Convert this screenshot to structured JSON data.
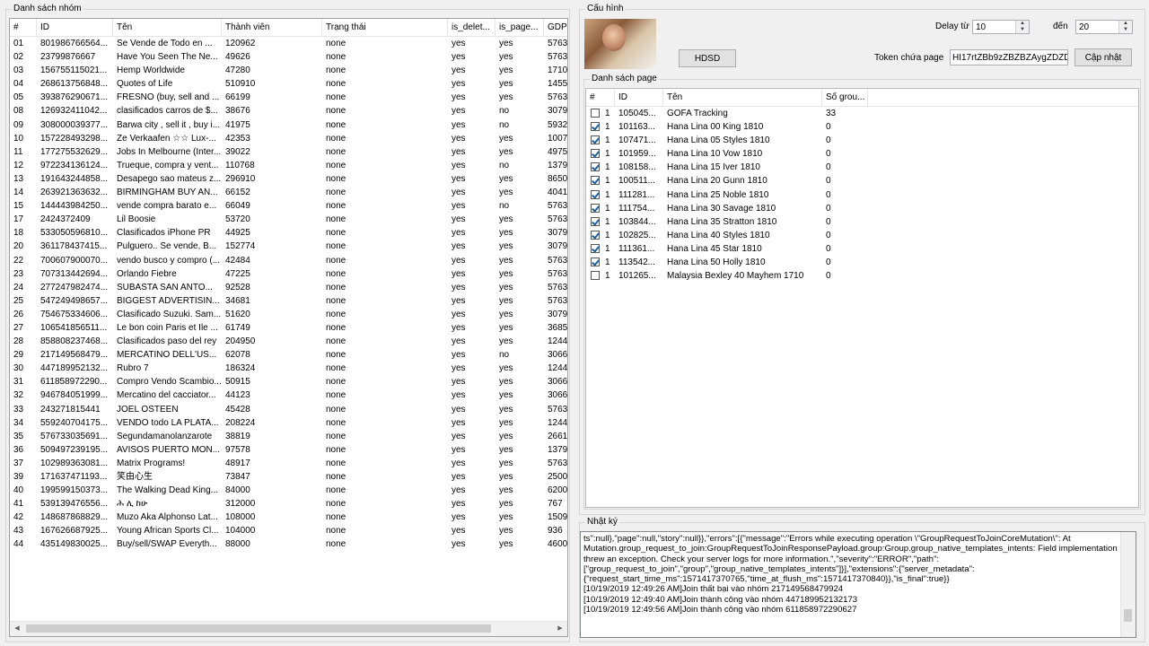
{
  "groups_panel": {
    "title": "Danh sách nhóm",
    "columns": [
      "#",
      "ID",
      "Tên",
      "Thành viên",
      "Trạng thái",
      "is_delet...",
      "is_page...",
      "GDP"
    ],
    "rows": [
      [
        "01",
        "801986766564...",
        "Se Vende de Todo en ...",
        "120962",
        "none",
        "yes",
        "yes",
        "5763"
      ],
      [
        "02",
        "23799876667",
        "Have You Seen The Ne...",
        "49626",
        "none",
        "yes",
        "yes",
        "5763"
      ],
      [
        "03",
        "156755115021...",
        "Hemp Worldwide",
        "47280",
        "none",
        "yes",
        "yes",
        "1710"
      ],
      [
        "04",
        "268613756848...",
        "Quotes of Life",
        "510910",
        "none",
        "yes",
        "yes",
        "1455"
      ],
      [
        "05",
        "393876290671...",
        "FRESNO (buy, sell and ...",
        "66199",
        "none",
        "yes",
        "yes",
        "5763"
      ],
      [
        "08",
        "126932411042...",
        "clasificados carros de $...",
        "38676",
        "none",
        "yes",
        "no",
        "3079"
      ],
      [
        "09",
        "308000039377...",
        "Barwa city , sell it , buy i...",
        "41975",
        "none",
        "yes",
        "no",
        "5932"
      ],
      [
        "10",
        "157228493298...",
        "Ze Verkaafen ☆☆ Lux-...",
        "42353",
        "none",
        "yes",
        "yes",
        "1007"
      ],
      [
        "11",
        "177275532629...",
        "Jobs In Melbourne (Inter...",
        "39022",
        "none",
        "yes",
        "yes",
        "4975"
      ],
      [
        "12",
        "972234136124...",
        "Trueque, compra y vent...",
        "110768",
        "none",
        "yes",
        "no",
        "1379"
      ],
      [
        "13",
        "191643244858...",
        "Desapego sao mateus z...",
        "296910",
        "none",
        "yes",
        "yes",
        "8650"
      ],
      [
        "14",
        "263921363632...",
        "BIRMINGHAM BUY AN...",
        "66152",
        "none",
        "yes",
        "yes",
        "4041"
      ],
      [
        "15",
        "144443984250...",
        "vende compra barato e...",
        "66049",
        "none",
        "yes",
        "no",
        "5763"
      ],
      [
        "17",
        "2424372409",
        "Lil Boosie",
        "53720",
        "none",
        "yes",
        "yes",
        "5763"
      ],
      [
        "18",
        "533050596810...",
        "Clasificados iPhone PR",
        "44925",
        "none",
        "yes",
        "yes",
        "3079"
      ],
      [
        "20",
        "361178437415...",
        "Pulguero.. Se vende, B...",
        "152774",
        "none",
        "yes",
        "yes",
        "3079"
      ],
      [
        "22",
        "700607900070...",
        "vendo busco y compro (...",
        "42484",
        "none",
        "yes",
        "yes",
        "5763"
      ],
      [
        "23",
        "707313442694...",
        "Orlando Fiebre",
        "47225",
        "none",
        "yes",
        "yes",
        "5763"
      ],
      [
        "24",
        "277247982474...",
        "SUBASTA SAN ANTO...",
        "92528",
        "none",
        "yes",
        "yes",
        "5763"
      ],
      [
        "25",
        "547249498657...",
        "BIGGEST ADVERTISIN...",
        "34681",
        "none",
        "yes",
        "yes",
        "5763"
      ],
      [
        "26",
        "754675334606...",
        "Clasificado Suzuki. Sam...",
        "51620",
        "none",
        "yes",
        "yes",
        "3079"
      ],
      [
        "27",
        "106541856511...",
        "Le bon coin Paris et Ile ...",
        "61749",
        "none",
        "yes",
        "yes",
        "3685"
      ],
      [
        "28",
        "858808237468...",
        "Clasificados paso del rey",
        "204950",
        "none",
        "yes",
        "yes",
        "1244"
      ],
      [
        "29",
        "217149568479...",
        "MERCATINO DELL'US...",
        "62078",
        "none",
        "yes",
        "no",
        "3066"
      ],
      [
        "30",
        "447189952132...",
        "Rubro 7",
        "186324",
        "none",
        "yes",
        "yes",
        "1244"
      ],
      [
        "31",
        "611858972290...",
        "Compro Vendo Scambio...",
        "50915",
        "none",
        "yes",
        "yes",
        "3066"
      ],
      [
        "32",
        "946784051999...",
        "Mercatino del cacciator...",
        "44123",
        "none",
        "yes",
        "yes",
        "3066"
      ],
      [
        "33",
        "243271815441",
        "JOEL OSTEEN",
        "45428",
        "none",
        "yes",
        "yes",
        "5763"
      ],
      [
        "34",
        "559240704175...",
        "VENDO todo LA PLATA...",
        "208224",
        "none",
        "yes",
        "yes",
        "1244"
      ],
      [
        "35",
        "576733035691...",
        "Segundamanolanzarote",
        "38819",
        "none",
        "yes",
        "yes",
        "2661"
      ],
      [
        "36",
        "509497239195...",
        "AVISOS PUERTO MON...",
        "97578",
        "none",
        "yes",
        "yes",
        "1379"
      ],
      [
        "37",
        "102989363081...",
        "Matrix Programs!",
        "48917",
        "none",
        "yes",
        "yes",
        "5763"
      ],
      [
        "39",
        "171637471193...",
        "笑由心生",
        "73847",
        "none",
        "yes",
        "yes",
        "2500"
      ],
      [
        "40",
        "199599150373...",
        "The Walking Dead King...",
        "84000",
        "none",
        "yes",
        "yes",
        "6200"
      ],
      [
        "41",
        "539139476556...",
        "ሕ ሊ ከሁ",
        "312000",
        "none",
        "yes",
        "yes",
        "767"
      ],
      [
        "42",
        "148687868829...",
        "Muzo Aka Alphonso Lat...",
        "108000",
        "none",
        "yes",
        "yes",
        "1509"
      ],
      [
        "43",
        "167626687925...",
        "Young African Sports Cl...",
        "104000",
        "none",
        "yes",
        "yes",
        "936"
      ],
      [
        "44",
        "435149830025...",
        "Buy/sell/SWAP Everyth...",
        "88000",
        "none",
        "yes",
        "yes",
        "4600"
      ]
    ]
  },
  "config_panel": {
    "title": "Cấu hình",
    "delay_from_label": "Delay từ",
    "delay_from_value": "10",
    "delay_to_label": "đến",
    "delay_to_value": "20",
    "hdsd_button": "HDSD",
    "token_label": "Token chứa page",
    "token_value": "HI17rtZBb9zZBZBZAygZDZD",
    "update_button": "Cập nhật",
    "pages_title": "Danh sách page",
    "pages_columns": [
      "#",
      "ID",
      "Tên",
      "Số grou..."
    ],
    "pages": [
      {
        "checked": false,
        "num": "1",
        "id": "105045...",
        "name": "GOFA Tracking",
        "groups": "33"
      },
      {
        "checked": true,
        "num": "1",
        "id": "101163...",
        "name": "Hana Lina 00 King 1810",
        "groups": "0"
      },
      {
        "checked": true,
        "num": "1",
        "id": "107471...",
        "name": "Hana Lina 05 Styles 1810",
        "groups": "0"
      },
      {
        "checked": true,
        "num": "1",
        "id": "101959...",
        "name": "Hana Lina 10 Vow 1810",
        "groups": "0"
      },
      {
        "checked": true,
        "num": "1",
        "id": "108158...",
        "name": "Hana Lina 15 Iver 1810",
        "groups": "0"
      },
      {
        "checked": true,
        "num": "1",
        "id": "100511...",
        "name": "Hana Lina 20 Gunn 1810",
        "groups": "0"
      },
      {
        "checked": true,
        "num": "1",
        "id": "111281...",
        "name": "Hana Lina 25 Noble 1810",
        "groups": "0"
      },
      {
        "checked": true,
        "num": "1",
        "id": "111754...",
        "name": "Hana Lina 30 Savage 1810",
        "groups": "0"
      },
      {
        "checked": true,
        "num": "1",
        "id": "103844...",
        "name": "Hana Lina 35 Stratton 1810",
        "groups": "0"
      },
      {
        "checked": true,
        "num": "1",
        "id": "102825...",
        "name": "Hana Lina 40 Styles 1810",
        "groups": "0"
      },
      {
        "checked": true,
        "num": "1",
        "id": "111361...",
        "name": "Hana Lina 45 Star 1810",
        "groups": "0"
      },
      {
        "checked": true,
        "num": "1",
        "id": "113542...",
        "name": "Hana Lina 50 Holly 1810",
        "groups": "0"
      },
      {
        "checked": false,
        "num": "1",
        "id": "101265...",
        "name": "Malaysia Bexley 40 Mayhem 1710",
        "groups": "0"
      }
    ]
  },
  "log_panel": {
    "title": "Nhật ký",
    "lines": [
      "ts\":null},\"page\":null,\"story\":null}},\"errors\":[{\"message\":\"Errors while executing operation \\\"GroupRequestToJoinCoreMutation\\\": At",
      "Mutation.group_request_to_join:GroupRequestToJoinResponsePayload.group:Group.group_native_templates_intents: Field implementation",
      "threw an exception. Check your server logs for more information.\",\"severity\":\"ERROR\",\"path\":",
      "[\"group_request_to_join\",\"group\",\"group_native_templates_intents\"]}],\"extensions\":{\"server_metadata\":",
      "{\"request_start_time_ms\":1571417370765,\"time_at_flush_ms\":1571417370840}},\"is_final\":true}}",
      "[10/19/2019 12:49:26 AM]Join thất bại vào nhóm 217149568479924",
      "[10/19/2019 12:49:40 AM]Join thành công vào nhóm 447189952132173",
      "[10/19/2019 12:49:56 AM]Join thành công vào nhóm 611858972290627"
    ]
  },
  "colors": {
    "window_bg": "#f0f0f0",
    "grid_bg": "#ffffff",
    "checkbox_check": "#1e5fa0"
  },
  "icons": [
    "avatar-photo",
    "scroll-left-arrow",
    "scroll-right-arrow",
    "spin-up-arrow",
    "spin-down-arrow",
    "checkbox"
  ]
}
